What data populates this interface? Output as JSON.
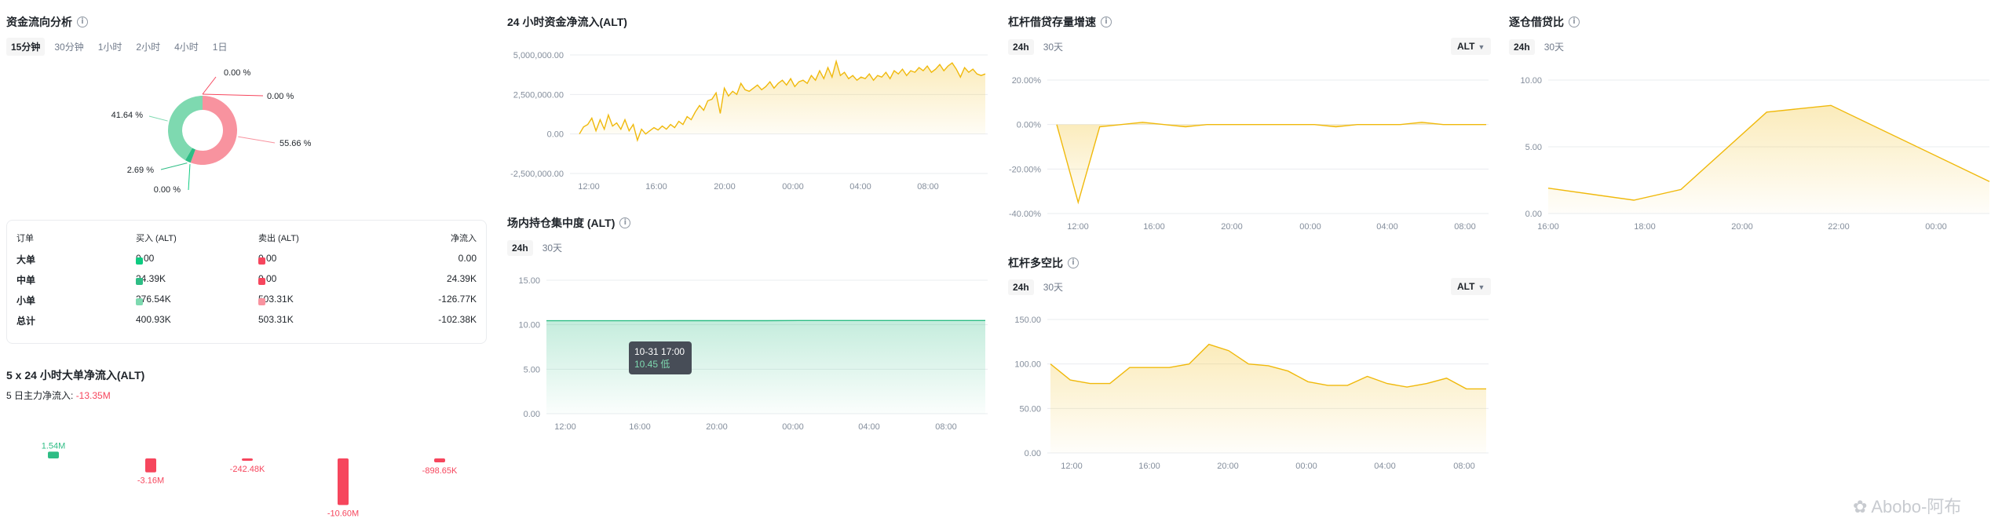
{
  "flow": {
    "title": "资金流向分析",
    "tabs": [
      "15分钟",
      "30分钟",
      "1小时",
      "2小时",
      "4小时",
      "1日"
    ],
    "active_tab": 0,
    "donut": {
      "labels": [
        "0.00 %",
        "0.00 %",
        "55.66 %",
        "0.00 %",
        "2.69 %",
        "41.64 %"
      ],
      "values": [
        0.001,
        0.001,
        55.66,
        0.001,
        2.69,
        41.64
      ],
      "colors": [
        "#f6465d",
        "#f6465d",
        "#f8939f",
        "#0ecb81",
        "#2ebd85",
        "#7ed9b0"
      ]
    },
    "table": {
      "headers": [
        "订单",
        "买入 (ALT)",
        "卖出 (ALT)",
        "净流入"
      ],
      "rows": [
        {
          "name": "大单",
          "buy": "0.00",
          "sell": "0.00",
          "net": "0.00"
        },
        {
          "name": "中单",
          "buy": "24.39K",
          "sell": "0.00",
          "net": "24.39K"
        },
        {
          "name": "小单",
          "buy": "376.54K",
          "sell": "503.31K",
          "net": "-126.77K"
        },
        {
          "name": "总计",
          "buy": "400.93K",
          "sell": "503.31K",
          "net": "-102.38K"
        }
      ],
      "buy_colors": [
        "#0ecb81",
        "#2ebd85",
        "#7ed9b0"
      ],
      "sell_colors": [
        "#f6465d",
        "#f6465d",
        "#f8939f"
      ]
    }
  },
  "big_orders": {
    "title": "5 x 24 小时大单净流入(ALT)",
    "subtitle_label": "5 日主力净流入:",
    "subtitle_value": "-13.35M",
    "chart_data": {
      "type": "bar",
      "values": [
        1.54,
        -3.16,
        -0.24248,
        -10.6,
        -0.89865
      ],
      "labels": [
        "1.54M",
        "-3.16M",
        "-242.48K",
        "-10.60M",
        "-898.65K"
      ],
      "pos_color": "#2ebd85",
      "neg_color": "#f6465d"
    }
  },
  "net_inflow": {
    "title": "24 小时资金净流入(ALT)",
    "chart_data": {
      "type": "area",
      "ylim": [
        -2500000,
        5000000
      ],
      "y_ticks": [
        "5,000,000.00",
        "2,500,000.00",
        "0.00",
        "-2,500,000.00"
      ],
      "x_ticks": [
        "12:00",
        "16:00",
        "20:00",
        "00:00",
        "04:00",
        "08:00"
      ],
      "values": [
        0,
        450000,
        600000,
        1000000,
        200000,
        900000,
        300000,
        1200000,
        500000,
        700000,
        300000,
        900000,
        200000,
        600000,
        -400000,
        300000,
        0,
        200000,
        400000,
        250000,
        500000,
        300000,
        600000,
        400000,
        800000,
        600000,
        1100000,
        900000,
        1400000,
        1800000,
        1500000,
        2100000,
        2200000,
        2600000,
        1300000,
        2900000,
        2400000,
        2700000,
        2500000,
        3200000,
        2800000,
        2700000,
        2900000,
        3100000,
        2800000,
        3000000,
        3300000,
        2900000,
        3200000,
        3400000,
        3100000,
        3500000,
        3000000,
        3300000,
        3400000,
        3200000,
        3700000,
        3400000,
        4000000,
        3500000,
        4200000,
        3600000,
        4600000,
        3700000,
        3900000,
        3500000,
        3700000,
        3400000,
        3600000,
        3500000,
        3800000,
        3400000,
        3700000,
        3600000,
        3900000,
        3500000,
        4000000,
        3800000,
        4100000,
        3700000,
        4000000,
        3900000,
        4200000,
        4000000,
        4300000,
        3900000,
        4100000,
        4400000,
        4000000,
        4300000,
        4500000,
        4100000,
        3600000,
        4200000,
        3900000,
        4100000,
        3800000,
        3700000,
        3800000
      ],
      "line_color": "#f0b90b"
    }
  },
  "concentration": {
    "title": "场内持仓集中度 (ALT)",
    "tabs": [
      "24h",
      "30天"
    ],
    "active_tab": 0,
    "chart_data": {
      "type": "area",
      "ylim": [
        0,
        15
      ],
      "y_ticks": [
        "15.00",
        "10.00",
        "5.00",
        "0.00"
      ],
      "x_ticks": [
        "12:00",
        "16:00",
        "20:00",
        "00:00",
        "04:00",
        "08:00"
      ],
      "values": [
        10.45,
        10.45,
        10.45,
        10.46,
        10.46,
        10.46,
        10.47,
        10.47,
        10.47,
        10.47,
        10.47
      ],
      "line_color": "#2ebd85"
    },
    "tooltip": {
      "time": "10-31 17:00",
      "value": "10.45 低"
    }
  },
  "margin_growth": {
    "title": "杠杆借贷存量增速",
    "tabs": [
      "24h",
      "30天"
    ],
    "active_tab": 0,
    "select": "ALT",
    "chart_data": {
      "type": "area",
      "ylim": [
        -40,
        20
      ],
      "y_ticks": [
        "20.00%",
        "0.00%",
        "-20.00%",
        "-40.00%"
      ],
      "x_ticks": [
        "12:00",
        "16:00",
        "20:00",
        "00:00",
        "04:00",
        "08:00"
      ],
      "values": [
        0,
        -35,
        -1,
        0,
        1,
        0,
        -1,
        0,
        0,
        0,
        0,
        0,
        0,
        -1,
        0,
        0,
        0,
        1,
        0,
        0,
        0
      ],
      "line_color": "#f0b90b"
    }
  },
  "long_short": {
    "title": "杠杆多空比",
    "tabs": [
      "24h",
      "30天"
    ],
    "active_tab": 0,
    "select": "ALT",
    "chart_data": {
      "type": "area",
      "ylim": [
        0,
        150
      ],
      "y_ticks": [
        "150.00",
        "100.00",
        "50.00",
        "0.00"
      ],
      "x_ticks": [
        "12:00",
        "16:00",
        "20:00",
        "00:00",
        "04:00",
        "08:00"
      ],
      "values": [
        100,
        82,
        78,
        78,
        96,
        96,
        96,
        100,
        122,
        115,
        100,
        98,
        92,
        80,
        76,
        76,
        86,
        78,
        74,
        78,
        84,
        72,
        72
      ],
      "line_color": "#f0b90b"
    }
  },
  "isolated": {
    "title": "逐仓借贷比",
    "tabs": [
      "24h",
      "30天"
    ],
    "active_tab": 0,
    "chart_data": {
      "type": "area",
      "ylim": [
        0,
        10
      ],
      "y_ticks": [
        "10.00",
        "5.00",
        "0.00"
      ],
      "x_ticks": [
        "16:00",
        "18:00",
        "20:00",
        "22:00",
        "00:00"
      ],
      "x": [
        14.9,
        16.9,
        18,
        20,
        21.5,
        25.2
      ],
      "values": [
        1.9,
        1.0,
        1.8,
        7.6,
        8.1,
        2.4
      ],
      "line_color": "#f0b90b"
    }
  },
  "watermark": "Abobo-阿布"
}
